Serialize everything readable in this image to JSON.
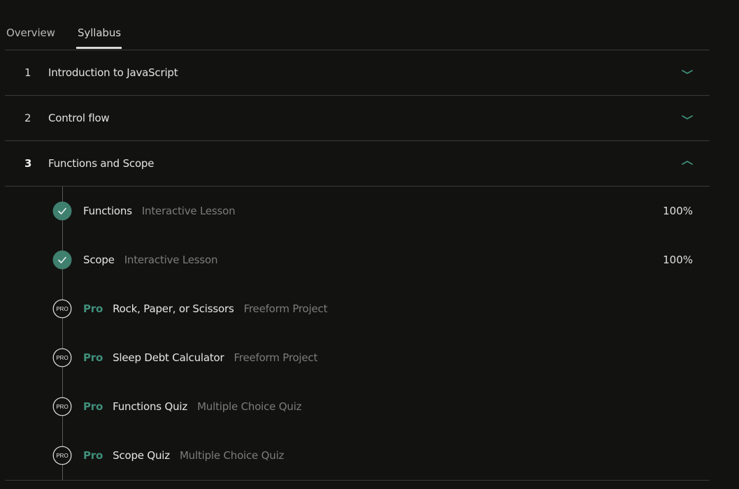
{
  "tabs": [
    {
      "label": "Overview",
      "active": false
    },
    {
      "label": "Syllabus",
      "active": true
    }
  ],
  "modules": [
    {
      "number": "1",
      "title": "Introduction to JavaScript",
      "expanded": false
    },
    {
      "number": "2",
      "title": "Control flow",
      "expanded": false
    },
    {
      "number": "3",
      "title": "Functions and Scope",
      "expanded": true
    }
  ],
  "lessons": [
    {
      "pro": "",
      "name": "Functions",
      "type": "Interactive Lesson",
      "progress": "100%",
      "status": "completed"
    },
    {
      "pro": "",
      "name": "Scope",
      "type": "Interactive Lesson",
      "progress": "100%",
      "status": "completed"
    },
    {
      "pro": "Pro",
      "name": "Rock, Paper, or Scissors",
      "type": "Freeform Project",
      "progress": "",
      "status": "pro",
      "badge": "PRO"
    },
    {
      "pro": "Pro",
      "name": "Sleep Debt Calculator",
      "type": "Freeform Project",
      "progress": "",
      "status": "pro",
      "badge": "PRO"
    },
    {
      "pro": "Pro",
      "name": "Functions Quiz",
      "type": "Multiple Choice Quiz",
      "progress": "",
      "status": "pro",
      "badge": "PRO"
    },
    {
      "pro": "Pro",
      "name": "Scope Quiz",
      "type": "Multiple Choice Quiz",
      "progress": "",
      "status": "pro",
      "badge": "PRO"
    }
  ],
  "colors": {
    "background": "#121211",
    "accent": "#3f8f7a",
    "check_fill": "#3f7f6e",
    "divider": "#3a3a39"
  },
  "icons": {
    "collapsed": "chevron-down-icon",
    "expanded": "chevron-up-icon",
    "completed": "check-circle-icon",
    "pro": "pro-badge-icon"
  }
}
